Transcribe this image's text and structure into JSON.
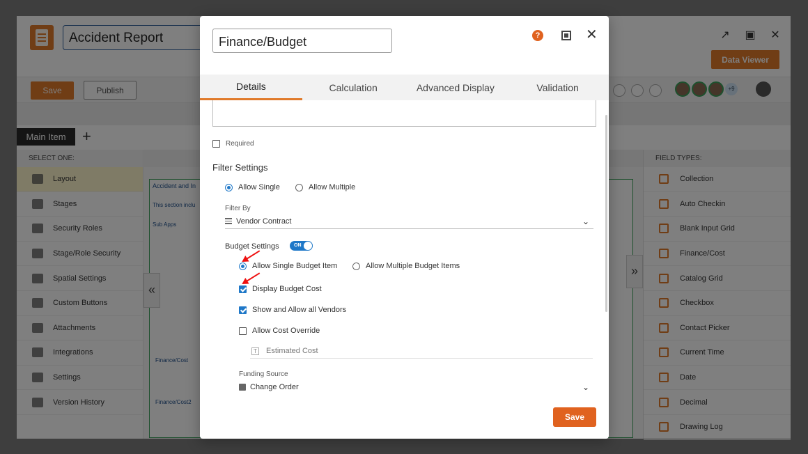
{
  "app": {
    "title": "Accident Report",
    "data_viewer_label": "Data Viewer",
    "save_label": "Save",
    "publish_label": "Publish",
    "avatar_more": "+9",
    "main_tab": "Main Item",
    "add_tab": "+",
    "left_header": "SELECT ONE:",
    "left_items": [
      "Layout",
      "Stages",
      "Security Roles",
      "Stage/Role Security",
      "Spatial Settings",
      "Custom Buttons",
      "Attachments",
      "Integrations",
      "Settings",
      "Version History"
    ],
    "right_header": "FIELD TYPES:",
    "right_items": [
      "Collection",
      "Auto Checkin",
      "Blank Input Grid",
      "Finance/Cost",
      "Catalog Grid",
      "Checkbox",
      "Contact Picker",
      "Current Time",
      "Date",
      "Decimal",
      "Drawing Log"
    ],
    "canvas_snippets": [
      "Accident and In",
      "This section inclu",
      "Sub Apps",
      "Finance/Cost",
      "Finance/Cost2"
    ],
    "collapse_left": "«",
    "collapse_right": "»"
  },
  "modal": {
    "title_value": "Finance/Budget",
    "help": "?",
    "tabs": [
      "Details",
      "Calculation",
      "Advanced Display",
      "Validation"
    ],
    "active_tab": "Details",
    "required_label": "Required",
    "filter_settings": "Filter Settings",
    "allow_single": "Allow Single",
    "allow_multiple": "Allow Multiple",
    "filter_by_label": "Filter By",
    "filter_by_value": "Vendor Contract",
    "budget_settings": "Budget Settings",
    "toggle_text": "ON",
    "allow_single_budget": "Allow Single Budget Item",
    "allow_multiple_budget": "Allow Multiple Budget Items",
    "display_budget_cost": "Display Budget Cost",
    "show_allow_vendors": "Show and Allow all Vendors",
    "allow_cost_override": "Allow Cost Override",
    "estimated_cost": "Estimated Cost",
    "funding_source_label": "Funding Source",
    "funding_source_value": "Change Order",
    "save_label": "Save"
  },
  "colors": {
    "accent_orange": "#e07a2a",
    "check_blue": "#1f78c8",
    "annotation_red": "#e11111"
  }
}
